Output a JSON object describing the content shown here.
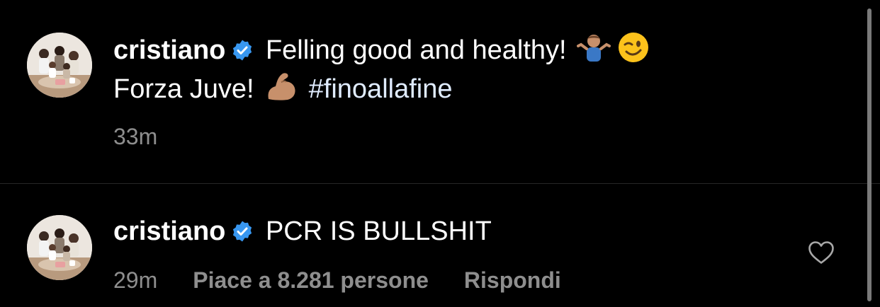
{
  "caption": {
    "username": "cristiano",
    "text_line1": "Felling good and healthy!",
    "text_line2": "Forza Juve!",
    "hashtag": "#finoallafine",
    "emojis": [
      "man-shrugging-emoji",
      "winking-face-emoji",
      "flexed-biceps-emoji"
    ],
    "timestamp": "33m"
  },
  "comment": {
    "username": "cristiano",
    "text": "PCR IS BULLSHIT",
    "timestamp": "29m",
    "likes_label": "Piace a 8.281 persone",
    "reply_label": "Rispondi"
  },
  "colors": {
    "background": "#000000",
    "text": "#ffffff",
    "meta": "#8e8e8e",
    "verified_badge": "#3897f0",
    "divider": "#262626"
  }
}
